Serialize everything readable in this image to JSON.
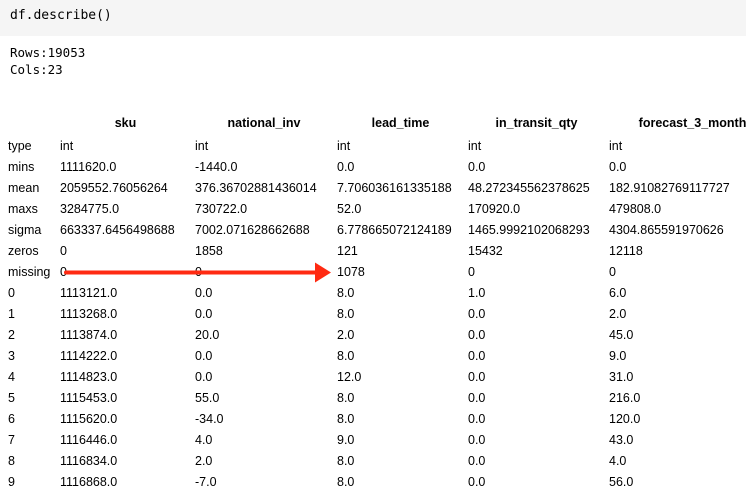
{
  "code_cell": {
    "source": "df.describe()"
  },
  "stdout": {
    "rows_line": "Rows:19053",
    "cols_line": "Cols:23"
  },
  "table": {
    "columns": [
      "sku",
      "national_inv",
      "lead_time",
      "in_transit_qty",
      "forecast_3_month"
    ],
    "rows": [
      {
        "index": "type",
        "cells": [
          "int",
          "int",
          "int",
          "int",
          "int"
        ]
      },
      {
        "index": "mins",
        "cells": [
          "1111620.0",
          "-1440.0",
          "0.0",
          "0.0",
          "0.0"
        ]
      },
      {
        "index": "mean",
        "cells": [
          "2059552.76056264",
          "376.36702881436014",
          "7.706036161335188",
          "48.272345562378625",
          "182.91082769117727"
        ]
      },
      {
        "index": "maxs",
        "cells": [
          "3284775.0",
          "730722.0",
          "52.0",
          "170920.0",
          "479808.0"
        ]
      },
      {
        "index": "sigma",
        "cells": [
          "663337.6456498688",
          "7002.071628662688",
          "6.778665072124189",
          "1465.9992102068293",
          "4304.865591970626"
        ]
      },
      {
        "index": "zeros",
        "cells": [
          "0",
          "1858",
          "121",
          "15432",
          "12118"
        ]
      },
      {
        "index": "missing",
        "cells": [
          "0",
          "0",
          "1078",
          "0",
          "0"
        ]
      },
      {
        "index": "0",
        "cells": [
          "1113121.0",
          "0.0",
          "8.0",
          "1.0",
          "6.0"
        ]
      },
      {
        "index": "1",
        "cells": [
          "1113268.0",
          "0.0",
          "8.0",
          "0.0",
          "2.0"
        ]
      },
      {
        "index": "2",
        "cells": [
          "1113874.0",
          "20.0",
          "2.0",
          "0.0",
          "45.0"
        ]
      },
      {
        "index": "3",
        "cells": [
          "1114222.0",
          "0.0",
          "8.0",
          "0.0",
          "9.0"
        ]
      },
      {
        "index": "4",
        "cells": [
          "1114823.0",
          "0.0",
          "12.0",
          "0.0",
          "31.0"
        ]
      },
      {
        "index": "5",
        "cells": [
          "1115453.0",
          "55.0",
          "8.0",
          "0.0",
          "216.0"
        ]
      },
      {
        "index": "6",
        "cells": [
          "1115620.0",
          "-34.0",
          "8.0",
          "0.0",
          "120.0"
        ]
      },
      {
        "index": "7",
        "cells": [
          "1116446.0",
          "4.0",
          "9.0",
          "0.0",
          "43.0"
        ]
      },
      {
        "index": "8",
        "cells": [
          "1116834.0",
          "2.0",
          "8.0",
          "0.0",
          "4.0"
        ]
      },
      {
        "index": "9",
        "cells": [
          "1116868.0",
          "-7.0",
          "8.0",
          "0.0",
          "56.0"
        ]
      }
    ]
  },
  "annotation": {
    "arrow_color": "#ff2a12",
    "from_row": "missing",
    "from_column": "sku",
    "to_column": "lead_time"
  }
}
